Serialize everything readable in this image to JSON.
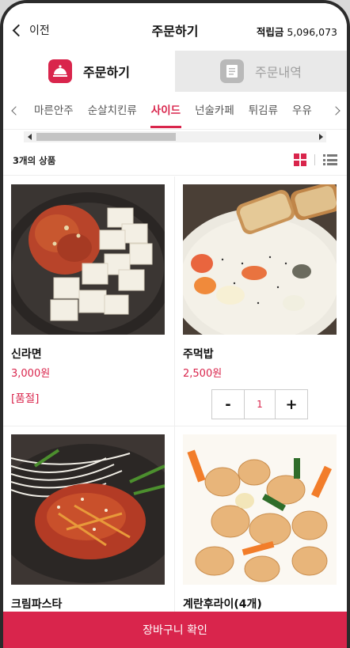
{
  "header": {
    "back_label": "이전",
    "title": "주문하기",
    "points_label": "적립금",
    "points_value": "5,096,073"
  },
  "mode_tabs": [
    {
      "label": "주문하기",
      "icon": "food-cloche-icon",
      "active": true
    },
    {
      "label": "주문내역",
      "icon": "receipt-icon",
      "active": false
    }
  ],
  "categories": [
    "마른안주",
    "순살치킨류",
    "사이드",
    "넌술카페",
    "튀김류",
    "우유"
  ],
  "active_category": "사이드",
  "list": {
    "count_text": "3개의 상품"
  },
  "products": [
    {
      "name": "신라면",
      "price": "3,000원",
      "status": "[품절]",
      "image": "tofu-kimchi-plate"
    },
    {
      "name": "주먹밥",
      "price": "2,500원",
      "qty": "1",
      "minus": "-",
      "plus": "+",
      "image": "cream-stew-with-bread"
    },
    {
      "name": "크림파스타",
      "price": "",
      "image": "spicy-noodle-salad-plate"
    },
    {
      "name": "계란후라이(4개)",
      "price": "",
      "image": "sweet-and-sour-pork"
    }
  ],
  "cart_button_label": "장바구니 확인",
  "colors": {
    "accent": "#d9254c",
    "inactive_tab_bg": "#e9e9e9"
  }
}
